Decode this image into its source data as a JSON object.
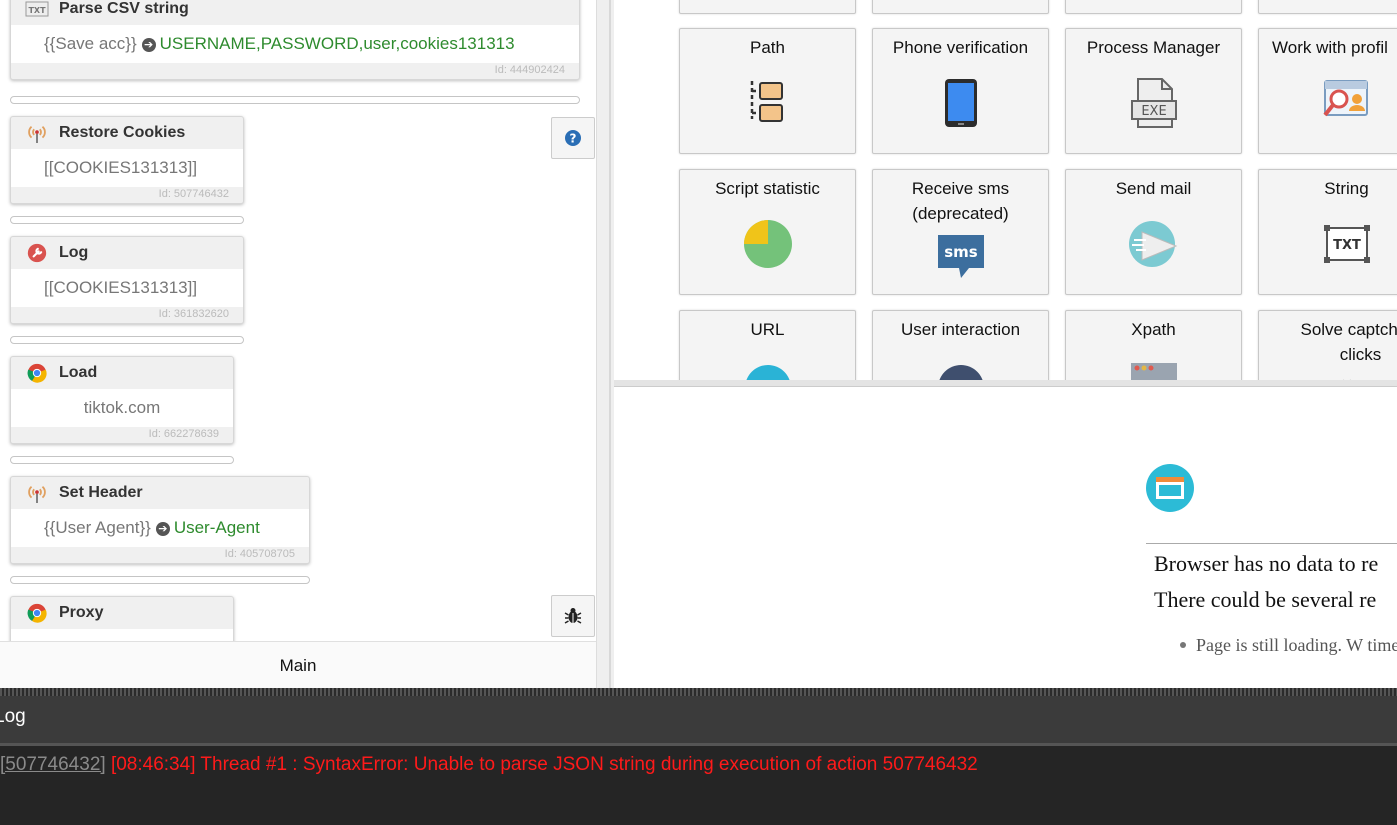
{
  "editor": {
    "actions": [
      {
        "title": "Parse CSV string",
        "var": "{{Save acc}}",
        "value": "USERNAME,PASSWORD,user,cookies131313",
        "id": "Id: 444902424",
        "icon": "txt-icon"
      },
      {
        "title": "Restore Cookies",
        "text": "[[COOKIES131313]]",
        "id": "Id: 507746432",
        "icon": "antenna-icon"
      },
      {
        "title": "Log",
        "text": "[[COOKIES131313]]",
        "id": "Id: 361832620",
        "icon": "wrench-icon"
      },
      {
        "title": "Load",
        "text": "tiktok.com",
        "id": "Id: 662278639",
        "icon": "chrome-icon"
      },
      {
        "title": "Set Header",
        "var": "{{User Agent}}",
        "value": "User-Agent",
        "id": "Id: 405708705",
        "icon": "antenna-icon"
      },
      {
        "title": "Proxy",
        "icon": "chrome-icon"
      }
    ],
    "help_icon": "question-icon",
    "debug_icon": "bug-icon",
    "footer_tab": "Main"
  },
  "tiles": [
    {
      "label": "Path",
      "icon": "folder-tree-icon"
    },
    {
      "label": "Phone verification",
      "icon": "phone-icon"
    },
    {
      "label": "Process Manager",
      "icon": "exe-file-icon"
    },
    {
      "label": "Work with profil",
      "icon": "profile-search-icon"
    },
    {
      "label": "Script statistic",
      "icon": "pie-chart-icon"
    },
    {
      "label": "Receive sms\n(deprecated)",
      "icon": "sms-icon",
      "sms_text": "sms"
    },
    {
      "label": "Send mail",
      "icon": "mail-send-icon"
    },
    {
      "label": "String",
      "icon": "txt-string-icon",
      "txt_text": "TXT"
    },
    {
      "label": "URL",
      "icon": "url-icon"
    },
    {
      "label": "User interaction",
      "icon": "user-icon"
    },
    {
      "label": "Xpath",
      "icon": "xpath-icon"
    },
    {
      "label": "Solve captcha v\nclicks",
      "icon": "captcha-icon"
    }
  ],
  "browser": {
    "icon": "browser-window-icon",
    "message1": "Browser has no data to re",
    "message2": "There could be several re",
    "bullet": "Page is still loading. W time."
  },
  "log": {
    "title": "Log",
    "entry_id": "[507746432]",
    "entry_msg": "[08:46:34] Thread #1 : SyntaxError: Unable to parse JSON string during execution of action 507746432"
  },
  "colors": {
    "green_value": "#2e8b2e",
    "log_error": "#ff1a1a",
    "log_bg": "#252525"
  }
}
